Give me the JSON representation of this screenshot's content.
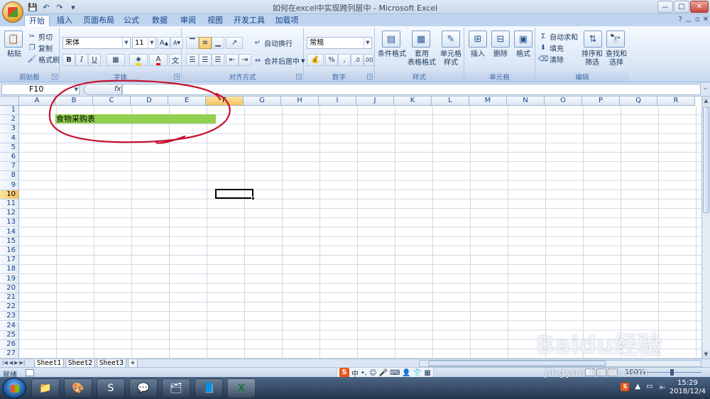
{
  "window": {
    "title": "如何在excel中实现跨列居中 - Microsoft Excel",
    "controls": [
      "－",
      "□",
      "✕"
    ]
  },
  "qat": {
    "save": "💾",
    "undo": "↶",
    "redo": "↷",
    "customize": "▾"
  },
  "tabs": [
    {
      "label": "开始",
      "active": true
    },
    {
      "label": "插入",
      "active": false
    },
    {
      "label": "页面布局",
      "active": false
    },
    {
      "label": "公式",
      "active": false
    },
    {
      "label": "数据",
      "active": false
    },
    {
      "label": "审阅",
      "active": false
    },
    {
      "label": "视图",
      "active": false
    },
    {
      "label": "开发工具",
      "active": false
    },
    {
      "label": "加载项",
      "active": false
    }
  ],
  "doc_controls": [
    "?",
    "－",
    "▫",
    "✕"
  ],
  "ribbon": {
    "clipboard": {
      "label": "剪贴板",
      "paste": "粘贴",
      "cut": "剪切",
      "copy": "复制",
      "format_painter": "格式刷"
    },
    "font": {
      "label": "字体",
      "font_name": "宋体",
      "font_size": "11",
      "bold": "B",
      "italic": "I",
      "underline": "U",
      "grow": "A",
      "shrink": "A"
    },
    "alignment": {
      "label": "对齐方式",
      "wrap": "自动换行",
      "merge": "合并后居中"
    },
    "number": {
      "label": "数字",
      "format": "常规",
      "percent": "%",
      "comma": ","
    },
    "styles": {
      "label": "样式",
      "conditional": "条件格式",
      "table_1": "套用",
      "table_2": "表格格式",
      "cell_1": "单元格",
      "cell_2": "样式"
    },
    "cells": {
      "label": "单元格",
      "insert": "插入",
      "delete": "删除",
      "format": "格式"
    },
    "editing": {
      "label": "编辑",
      "autosum": "自动求和",
      "fill": "填充",
      "clear": "清除",
      "sort_1": "排序和",
      "sort_2": "筛选",
      "find_1": "查找和",
      "find_2": "选择"
    }
  },
  "formula_bar": {
    "name_box": "F10",
    "fx": "fx",
    "value": ""
  },
  "columns": [
    "A",
    "B",
    "C",
    "D",
    "E",
    "F",
    "G",
    "H",
    "I",
    "J",
    "K",
    "L",
    "M",
    "N",
    "O",
    "P",
    "Q",
    "R"
  ],
  "selected_column": "F",
  "rows": [
    "1",
    "2",
    "3",
    "4",
    "5",
    "6",
    "7",
    "8",
    "9",
    "10",
    "11",
    "12",
    "13",
    "14",
    "15",
    "16",
    "17",
    "18",
    "19",
    "20",
    "21",
    "22",
    "23",
    "24",
    "25",
    "26",
    "27"
  ],
  "selected_row": "10",
  "merged_cell": {
    "range": "B2:E2",
    "text": "食物采购表",
    "fill": "#92d050"
  },
  "annotation_color": "#c8102e",
  "sheets": [
    {
      "name": "Sheet1",
      "active": true
    },
    {
      "name": "Sheet2",
      "active": false
    },
    {
      "name": "Sheet3",
      "active": false
    }
  ],
  "status": {
    "ready": "就绪",
    "zoom": "100%"
  },
  "ime": {
    "logo": "S",
    "mode": "中"
  },
  "taskbar": {
    "apps": [
      {
        "name": "folder",
        "glyph": "📁"
      },
      {
        "name": "paint",
        "glyph": "🎨"
      },
      {
        "name": "sogou",
        "glyph": "S"
      },
      {
        "name": "wechat",
        "glyph": "💬"
      },
      {
        "name": "explorer",
        "glyph": "🗂"
      },
      {
        "name": "notes",
        "glyph": "📘"
      },
      {
        "name": "excel",
        "glyph": "X"
      }
    ],
    "tray_logo": "S",
    "time": "15:29",
    "date": "2018/12/4"
  },
  "watermark": {
    "text": "Baidu经验",
    "url": "jingyan.baidu.com"
  }
}
